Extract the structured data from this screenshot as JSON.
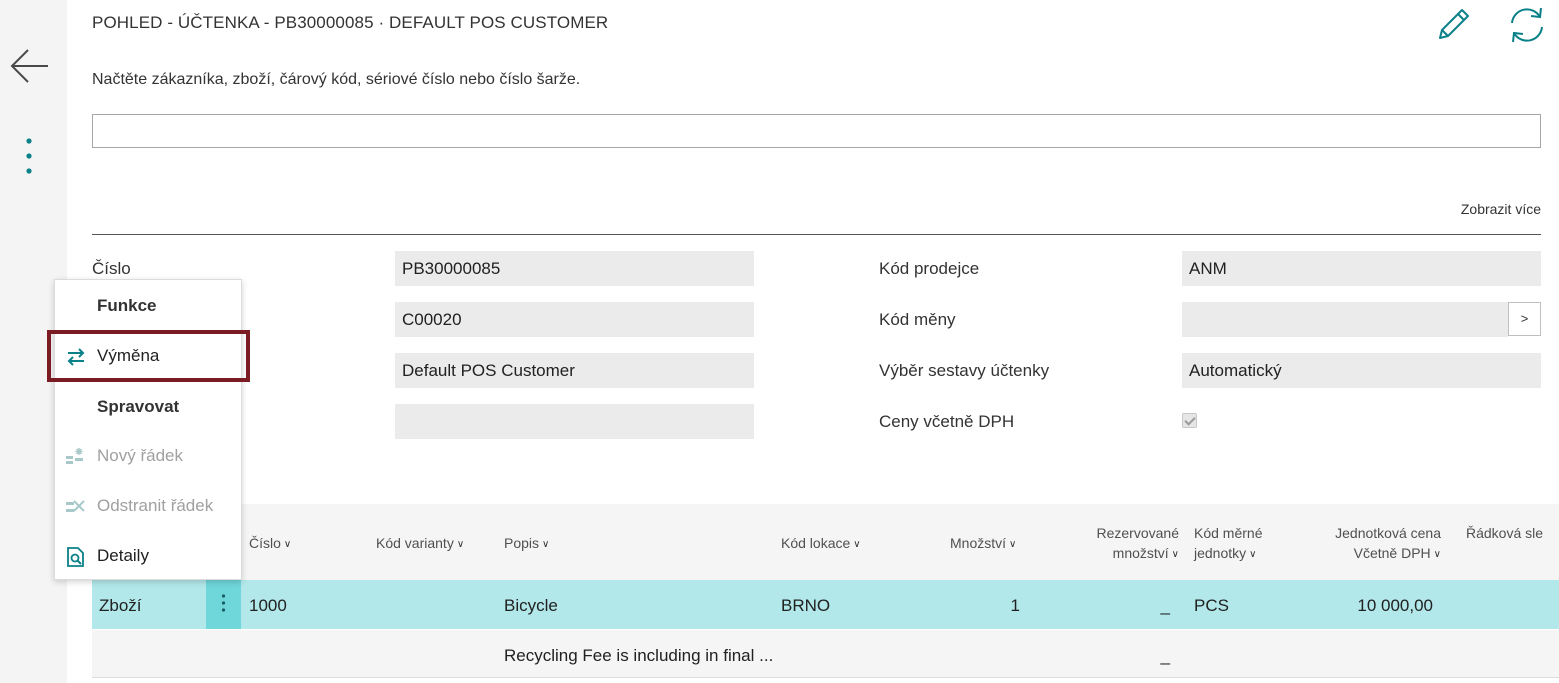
{
  "header": {
    "title": "POHLED - ÚČTENKA - PB30000085 · DEFAULT POS CUSTOMER",
    "edit_icon": "pencil-icon",
    "refresh_icon": "refresh-icon",
    "accent_color": "#0a8188"
  },
  "scan": {
    "label": "Načtěte zákazníka, zboží, čárový kód, sériové číslo nebo číslo šarže.",
    "value": ""
  },
  "show_more": "Zobrazit více",
  "fields_left": {
    "cislo_label": "Číslo",
    "cislo_value": "PB30000085",
    "customer_no": "C00020",
    "customer_name": "Default POS Customer",
    "empty_value": ""
  },
  "fields_right": {
    "salesperson_label": "Kód prodejce",
    "salesperson_value": "ANM",
    "currency_label": "Kód měny",
    "currency_value": "",
    "lookup_label": ">",
    "report_label": "Výběr sestavy účtenky",
    "report_value": "Automatický",
    "prices_vat_label": "Ceny včetně DPH",
    "prices_vat_checked": true
  },
  "menu": {
    "group1": "Funkce",
    "exchange": "Výměna",
    "group2": "Spravovat",
    "new_line": "Nový řádek",
    "delete_line": "Odstranit řádek",
    "details": "Detaily"
  },
  "lines": {
    "columns": {
      "no": "Číslo",
      "variant": "Kód varianty",
      "description": "Popis",
      "location": "Kód lokace",
      "quantity": "Množství",
      "reserved_1": "Rezervované",
      "reserved_2": "množství",
      "uom_1": "Kód měrné",
      "uom_2": "jednotky",
      "price_1": "Jednotková cena",
      "price_2": "Včetně DPH",
      "line_discount": "Řádková sle"
    },
    "rows": [
      {
        "type": "Zboží",
        "no": "1000",
        "description": "Bicycle",
        "location": "BRNO",
        "quantity": "1",
        "reserved": "_",
        "uom": "PCS",
        "price": "10 000,00"
      },
      {
        "description": "Recycling Fee is including in final ...",
        "reserved": "_"
      }
    ]
  }
}
